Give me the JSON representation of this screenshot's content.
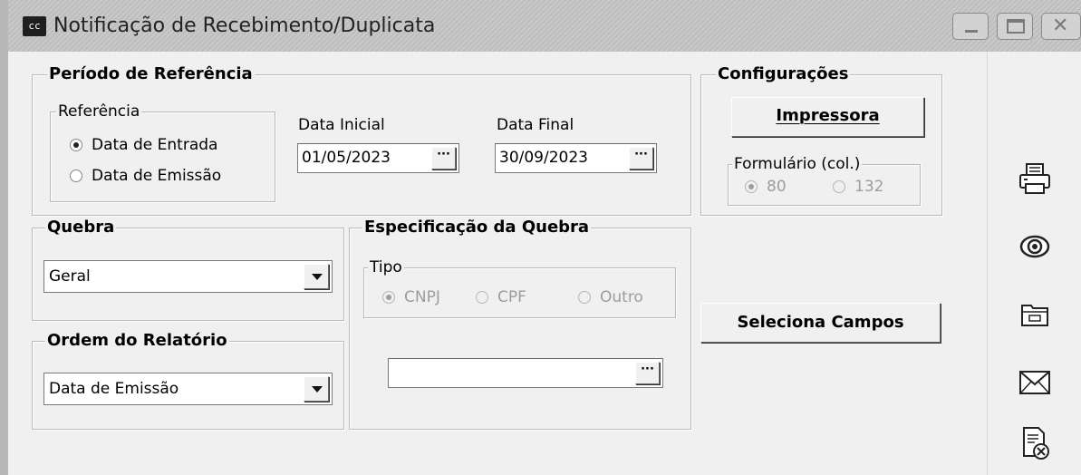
{
  "window": {
    "app_icon": "cc",
    "title": "Notificação de Recebimento/Duplicata",
    "minimize_icon": "minimize-icon",
    "maximize_icon": "maximize-icon",
    "close_icon": "close-icon"
  },
  "periodo": {
    "legend": "Período de Referência",
    "referencia": {
      "legend": "Referência",
      "options": [
        "Data de Entrada",
        "Data de Emissão"
      ],
      "selected": "Data de Entrada"
    },
    "data_inicial": {
      "label": "Data Inicial",
      "value": "01/05/2023",
      "button": "···"
    },
    "data_final": {
      "label": "Data Final",
      "value": "30/09/2023",
      "button": "···"
    }
  },
  "configuracoes": {
    "legend": "Configurações",
    "impressora_button": "Impressora",
    "formulario": {
      "legend": "Formulário (col.)",
      "options": [
        "80",
        "132"
      ],
      "selected": "80",
      "disabled": true
    }
  },
  "quebra": {
    "legend": "Quebra",
    "selected": "Geral"
  },
  "ordem": {
    "legend": "Ordem do Relatório",
    "selected": "Data de Emissão"
  },
  "especificacao": {
    "legend": "Especificação da Quebra",
    "tipo": {
      "legend": "Tipo",
      "options": [
        "CNPJ",
        "CPF",
        "Outro"
      ],
      "selected": "CNPJ",
      "disabled": true
    },
    "field_value": "",
    "field_button": "···"
  },
  "seleciona_campos_button": "Seleciona Campos",
  "sidebar_icons": [
    "printer-icon",
    "preview-eye-icon",
    "folder-icon",
    "email-envelope-icon",
    "cancel-document-icon"
  ],
  "colors": {
    "titlebar": "#c4c4c4",
    "window_bg": "#f0f0f0",
    "disabled_text": "#9d9d9d"
  }
}
